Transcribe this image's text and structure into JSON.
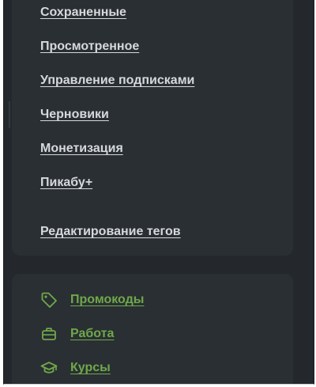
{
  "menu": {
    "items": [
      {
        "label": "Сохраненные"
      },
      {
        "label": "Просмотренное"
      },
      {
        "label": "Управление подписками"
      },
      {
        "label": "Черновики"
      },
      {
        "label": "Монетизация"
      },
      {
        "label": "Пикабу+"
      },
      {
        "label": "Редактирование тегов"
      }
    ]
  },
  "extras": {
    "items": [
      {
        "label": "Промокоды",
        "icon": "tag-icon"
      },
      {
        "label": "Работа",
        "icon": "briefcase-icon"
      },
      {
        "label": "Курсы",
        "icon": "graduation-cap-icon"
      }
    ],
    "accent_color": "#6fa84a"
  },
  "colors": {
    "background": "#24282c",
    "panel": "#2a2f33",
    "link": "#d6d9dc"
  }
}
